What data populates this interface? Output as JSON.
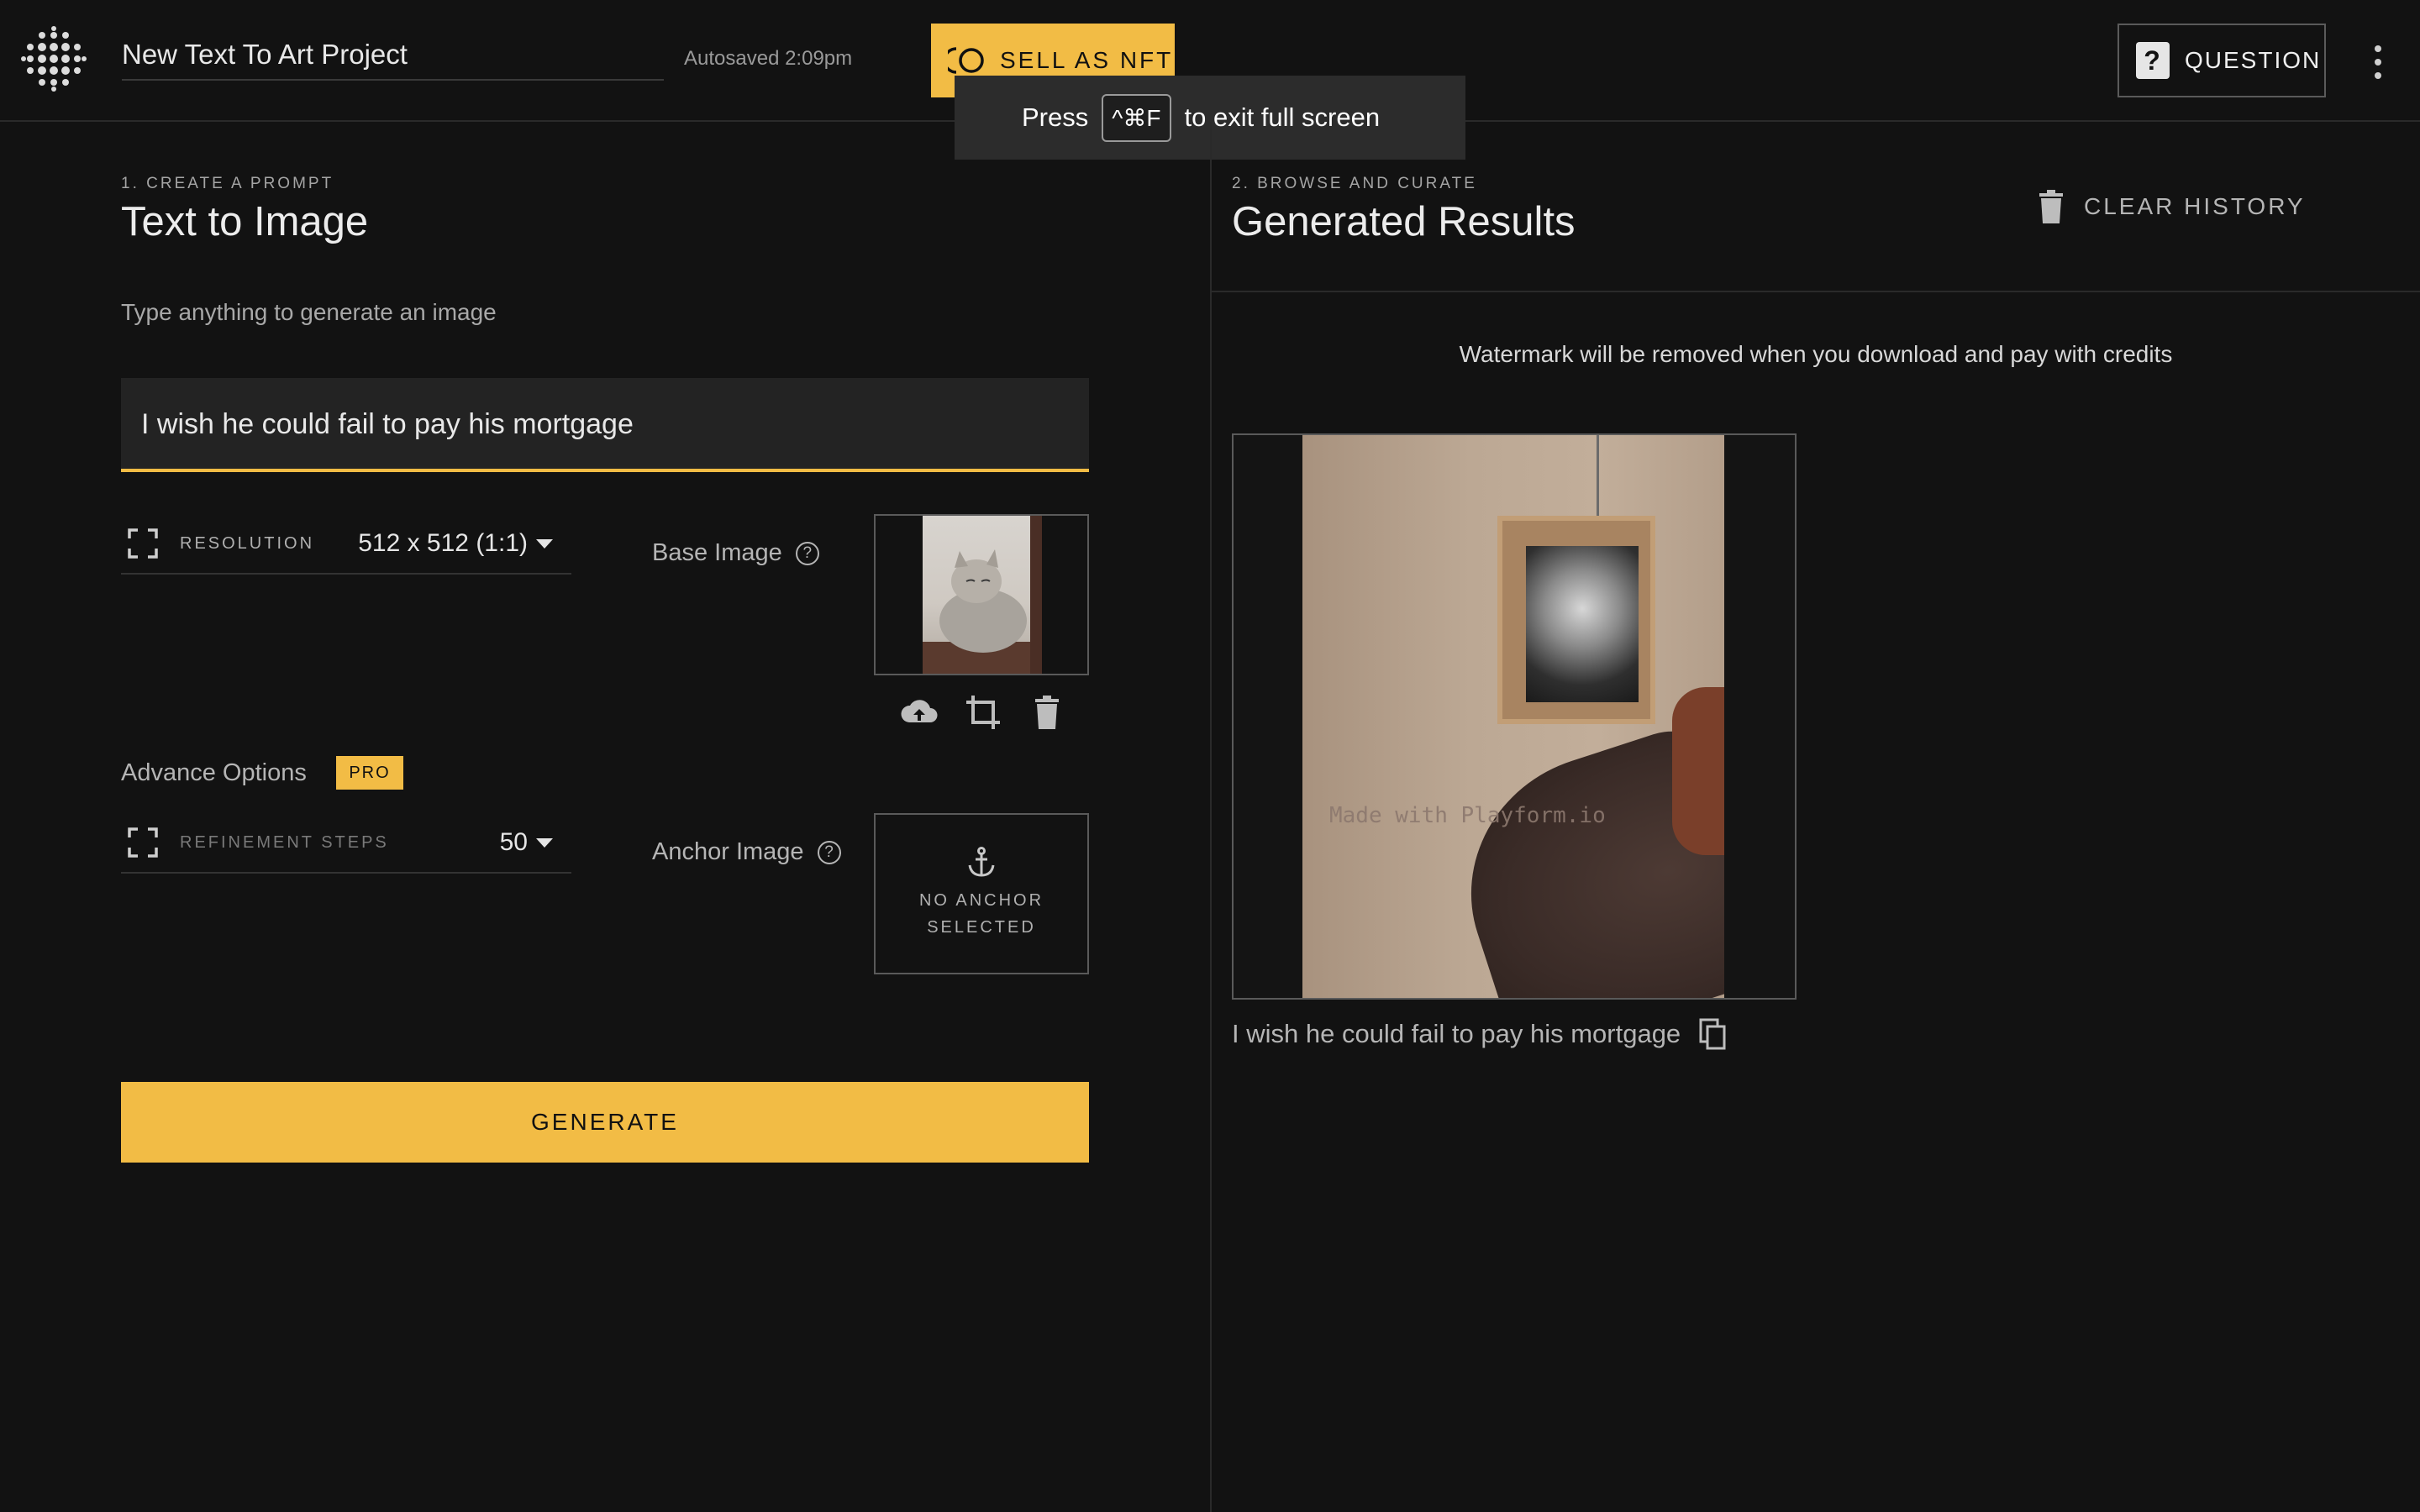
{
  "header": {
    "project_title": "New Text To Art Project",
    "autosave_status": "Autosaved 2:09pm",
    "sell_nft_label": "SELL AS NFT",
    "question_label": "QUESTION",
    "accent_color": "#f2bc45"
  },
  "fullscreen_toast": {
    "press": "Press",
    "key": "^⌘F",
    "message": "to exit full screen"
  },
  "left_panel": {
    "step_label": "1. CREATE A PROMPT",
    "title": "Text to Image",
    "hint": "Type anything to generate an image",
    "prompt_value": "I wish he could fail to pay his mortgage",
    "resolution": {
      "label": "RESOLUTION",
      "value": "512 x 512 (1:1)"
    },
    "base_image": {
      "label": "Base Image",
      "help": "?"
    },
    "advance_options": {
      "label": "Advance Options",
      "badge": "PRO"
    },
    "refinement_steps": {
      "label": "REFINEMENT STEPS",
      "value": "50"
    },
    "anchor_image": {
      "label": "Anchor Image",
      "help": "?",
      "empty_text": "NO ANCHOR SELECTED"
    },
    "generate_label": "GENERATE"
  },
  "right_panel": {
    "step_label": "2. BROWSE AND CURATE",
    "title": "Generated Results",
    "clear_history_label": "CLEAR HISTORY",
    "watermark_note": "Watermark will be removed when you download and pay with credits",
    "result": {
      "watermark_text": "Made with Playform.io",
      "caption": "I wish he could fail to pay his mortgage"
    }
  },
  "icons": {
    "logo": "dot-grid-logo-icon",
    "nft": "coin-icon",
    "question": "question-mark-icon",
    "menu": "kebab-menu-icon",
    "resolution": "expand-corners-icon",
    "refinement": "expand-corners-icon",
    "upload": "cloud-upload-icon",
    "crop": "crop-icon",
    "delete": "trash-icon",
    "anchor": "anchor-icon",
    "copy": "copy-icon"
  }
}
